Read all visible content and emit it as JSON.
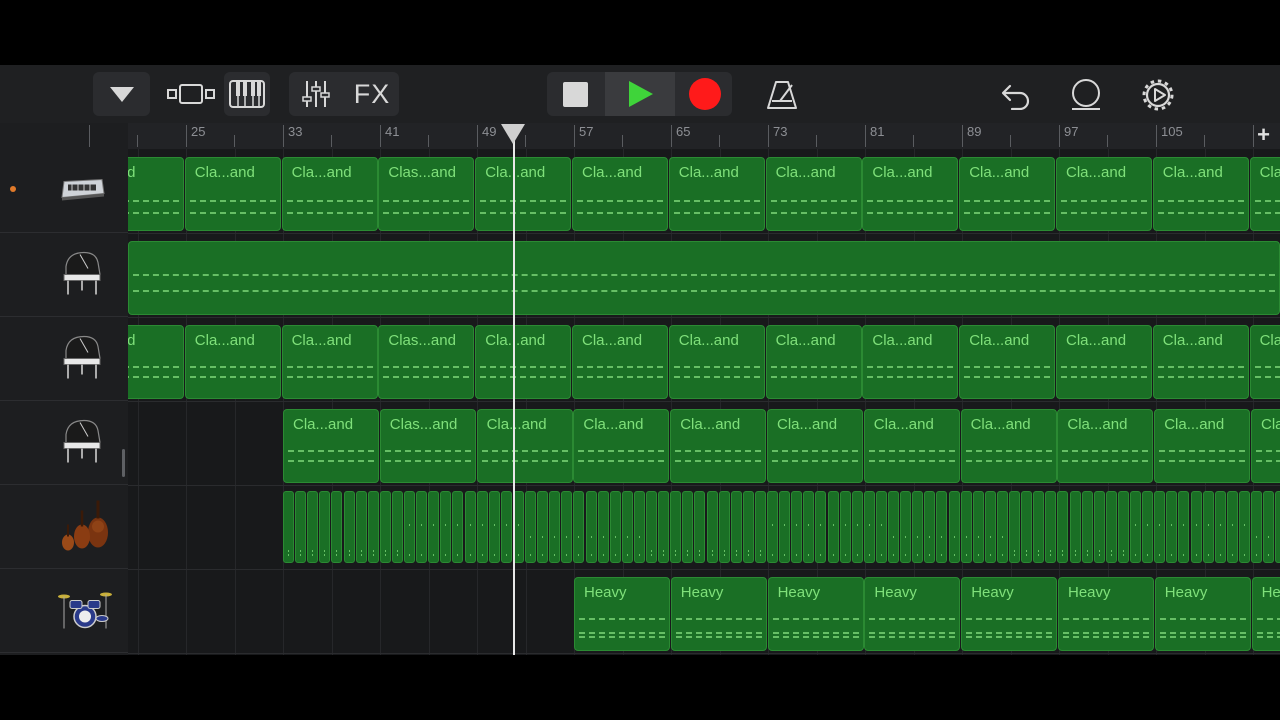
{
  "toolbar": {
    "fx_label": "FX",
    "colors": {
      "play": "#3fd43a",
      "record": "#ff1a1a"
    }
  },
  "ruler": {
    "labels": [
      "25",
      "33",
      "41",
      "49",
      "57",
      "65",
      "73",
      "81",
      "89",
      "97",
      "105"
    ],
    "add_label": "+"
  },
  "tracks": [
    {
      "instrument": "keyboard-synth-icon",
      "armed": true
    },
    {
      "instrument": "grand-piano-icon"
    },
    {
      "instrument": "grand-piano-icon"
    },
    {
      "instrument": "grand-piano-icon"
    },
    {
      "instrument": "strings-icon"
    },
    {
      "instrument": "drum-kit-icon"
    }
  ],
  "regions": {
    "t1": [
      "...and",
      "Cla...and",
      "Cla...and",
      "Clas...and",
      "Cla...and",
      "Cla...and",
      "Cla...and",
      "Cla...and",
      "Cla...and",
      "Cla...and",
      "Cla...and",
      "Cla...and",
      "Cla"
    ],
    "t3": [
      "...and",
      "Cla...and",
      "Cla...and",
      "Clas...and",
      "Cla...and",
      "Cla...and",
      "Cla...and",
      "Cla...and",
      "Cla...and",
      "Cla...and",
      "Cla...and",
      "Cla...and",
      "Cla"
    ],
    "t4": [
      "Cla...and",
      "Clas...and",
      "Cla...and",
      "Cla...and",
      "Cla...and",
      "Cla...and",
      "Cla...and",
      "Cla...and",
      "Cla...and",
      "Cla...and",
      "Cla"
    ],
    "t6": [
      "Heavy",
      "Heavy",
      "Heavy",
      "Heavy",
      "Heavy",
      "Heavy",
      "Heavy",
      "He"
    ]
  }
}
